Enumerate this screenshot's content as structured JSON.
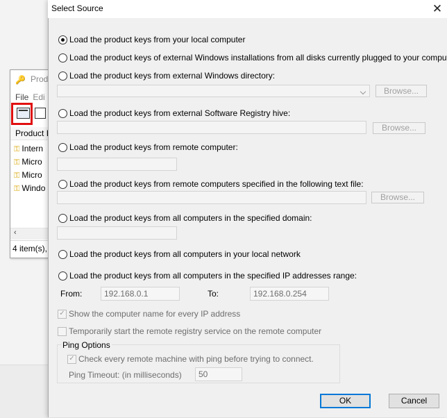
{
  "background_app": {
    "title": "Prod",
    "menu": [
      "File",
      "Edi"
    ],
    "column_header": "Product I",
    "rows": [
      "Intern",
      "Micro",
      "Micro",
      "Windo"
    ],
    "status": "4 item(s),"
  },
  "dialog": {
    "title": "Select Source",
    "options": {
      "local": "Load the product keys from your local computer",
      "external_disks": "Load the product keys of external Windows installations from all disks currently plugged to your computer",
      "external_dir": "Load the product keys from external Windows directory:",
      "registry_hive": "Load the product keys from external Software Registry hive:",
      "remote_computer": "Load the product keys from remote computer:",
      "remote_file": "Load the product keys from remote computers specified in the following text file:",
      "domain": "Load the product keys from all computers in the specified domain:",
      "local_network": "Load the product keys from all computers in your local network",
      "ip_range": "Load the product keys from all computers in the specified IP addresses range:"
    },
    "selected_option": "local",
    "browse_label": "Browse...",
    "ip_range": {
      "from_label": "From:",
      "from_value": "192.168.0.1",
      "to_label": "To:",
      "to_value": "192.168.0.254"
    },
    "show_computer_name": {
      "label": "Show the computer name for every IP address",
      "checked": true
    },
    "start_remote_registry": {
      "label": "Temporarily start the remote registry service on the remote computer",
      "checked": false
    },
    "ping": {
      "group_label": "Ping Options",
      "check_label": "Check every remote machine with ping before trying to connect.",
      "checked": true,
      "timeout_label": "Ping Timeout: (in milliseconds)",
      "timeout_value": "50"
    },
    "buttons": {
      "ok": "OK",
      "cancel": "Cancel"
    }
  },
  "colors": {
    "highlight_box": "#e01010",
    "ok_border": "#0078d7",
    "key_icon": "#d9a400"
  }
}
